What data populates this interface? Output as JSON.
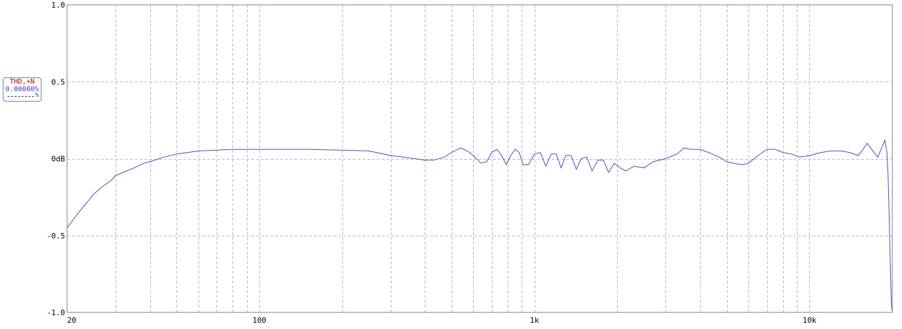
{
  "chart_data": {
    "type": "line",
    "x_scale": "log",
    "xlim": [
      20,
      20000
    ],
    "ylim": [
      -1.0,
      1.0
    ],
    "grid": true,
    "xticks": [
      {
        "value": 20,
        "label": "20"
      },
      {
        "value": 100,
        "label": "100"
      },
      {
        "value": 1000,
        "label": "1k"
      },
      {
        "value": 10000,
        "label": "10k"
      }
    ],
    "yticks": [
      {
        "value": 1.0,
        "label": "1.0"
      },
      {
        "value": 0.5,
        "label": "0.5"
      },
      {
        "value": 0.0,
        "label": "0dB"
      },
      {
        "value": -0.5,
        "label": "-0.5"
      },
      {
        "value": -1.0,
        "label": "-1.0"
      }
    ],
    "legend": {
      "placement": "left",
      "name": "THD,+N",
      "value": "0.00000%",
      "mark": "%"
    },
    "series_color": "#4a4ad2",
    "grid_color": "#b4b4e6",
    "series": [
      {
        "points": [
          [
            20,
            -0.45
          ],
          [
            21,
            -0.4
          ],
          [
            22,
            -0.35
          ],
          [
            23,
            -0.31
          ],
          [
            24,
            -0.27
          ],
          [
            25,
            -0.23
          ],
          [
            27,
            -0.18
          ],
          [
            29,
            -0.14
          ],
          [
            30,
            -0.11
          ],
          [
            32,
            -0.09
          ],
          [
            35,
            -0.06
          ],
          [
            38,
            -0.03
          ],
          [
            40,
            -0.02
          ],
          [
            45,
            0.01
          ],
          [
            50,
            0.03
          ],
          [
            55,
            0.04
          ],
          [
            60,
            0.05
          ],
          [
            70,
            0.055
          ],
          [
            80,
            0.06
          ],
          [
            100,
            0.06
          ],
          [
            150,
            0.06
          ],
          [
            200,
            0.055
          ],
          [
            250,
            0.05
          ],
          [
            300,
            0.02
          ],
          [
            350,
            0.005
          ],
          [
            400,
            -0.01
          ],
          [
            430,
            -0.01
          ],
          [
            470,
            0.01
          ],
          [
            500,
            0.04
          ],
          [
            540,
            0.07
          ],
          [
            570,
            0.05
          ],
          [
            600,
            0.02
          ],
          [
            640,
            -0.03
          ],
          [
            670,
            -0.02
          ],
          [
            700,
            0.04
          ],
          [
            730,
            0.06
          ],
          [
            760,
            0.02
          ],
          [
            790,
            -0.04
          ],
          [
            820,
            0.02
          ],
          [
            850,
            0.06
          ],
          [
            880,
            0.04
          ],
          [
            910,
            -0.04
          ],
          [
            950,
            -0.04
          ],
          [
            1000,
            0.03
          ],
          [
            1050,
            0.04
          ],
          [
            1100,
            -0.05
          ],
          [
            1150,
            0.03
          ],
          [
            1200,
            0.03
          ],
          [
            1250,
            -0.06
          ],
          [
            1300,
            0.02
          ],
          [
            1360,
            0.02
          ],
          [
            1420,
            -0.07
          ],
          [
            1480,
            0.0
          ],
          [
            1550,
            0.01
          ],
          [
            1620,
            -0.08
          ],
          [
            1700,
            -0.01
          ],
          [
            1780,
            -0.01
          ],
          [
            1860,
            -0.09
          ],
          [
            1950,
            -0.03
          ],
          [
            2050,
            -0.06
          ],
          [
            2150,
            -0.08
          ],
          [
            2300,
            -0.05
          ],
          [
            2500,
            -0.06
          ],
          [
            2700,
            -0.02
          ],
          [
            3000,
            0.0
          ],
          [
            3300,
            0.03
          ],
          [
            3500,
            0.07
          ],
          [
            3700,
            0.06
          ],
          [
            4000,
            0.06
          ],
          [
            4300,
            0.04
          ],
          [
            4700,
            0.01
          ],
          [
            5000,
            -0.02
          ],
          [
            5300,
            -0.03
          ],
          [
            5700,
            -0.04
          ],
          [
            6000,
            -0.03
          ],
          [
            6500,
            0.02
          ],
          [
            7000,
            0.06
          ],
          [
            7500,
            0.06
          ],
          [
            8000,
            0.04
          ],
          [
            8600,
            0.03
          ],
          [
            9200,
            0.01
          ],
          [
            10000,
            0.02
          ],
          [
            11000,
            0.04
          ],
          [
            12000,
            0.05
          ],
          [
            13000,
            0.05
          ],
          [
            14000,
            0.04
          ],
          [
            15000,
            0.02
          ],
          [
            15500,
            0.05
          ],
          [
            16200,
            0.1
          ],
          [
            17000,
            0.05
          ],
          [
            17700,
            0.01
          ],
          [
            18300,
            0.07
          ],
          [
            18800,
            0.12
          ],
          [
            19100,
            0.05
          ],
          [
            19300,
            -0.1
          ],
          [
            19500,
            -0.4
          ],
          [
            19700,
            -0.75
          ],
          [
            19850,
            -0.95
          ],
          [
            20000,
            -1.0
          ]
        ]
      }
    ]
  }
}
